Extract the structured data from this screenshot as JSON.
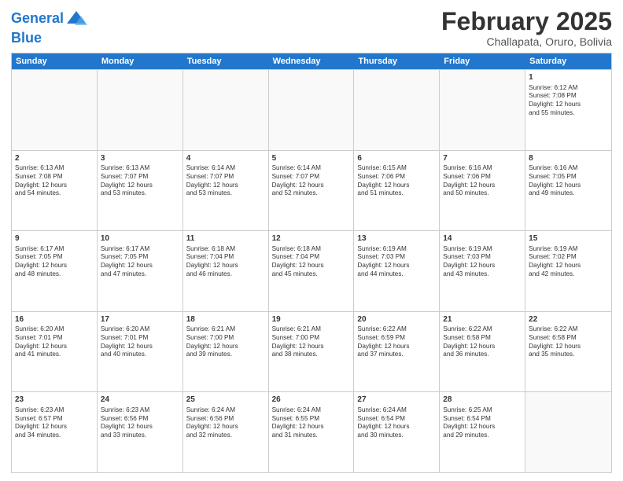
{
  "logo": {
    "line1": "General",
    "line2": "Blue"
  },
  "title": "February 2025",
  "location": "Challapata, Oruro, Bolivia",
  "days_of_week": [
    "Sunday",
    "Monday",
    "Tuesday",
    "Wednesday",
    "Thursday",
    "Friday",
    "Saturday"
  ],
  "weeks": [
    [
      {
        "day": "",
        "info": ""
      },
      {
        "day": "",
        "info": ""
      },
      {
        "day": "",
        "info": ""
      },
      {
        "day": "",
        "info": ""
      },
      {
        "day": "",
        "info": ""
      },
      {
        "day": "",
        "info": ""
      },
      {
        "day": "1",
        "info": "Sunrise: 6:12 AM\nSunset: 7:08 PM\nDaylight: 12 hours\nand 55 minutes."
      }
    ],
    [
      {
        "day": "2",
        "info": "Sunrise: 6:13 AM\nSunset: 7:08 PM\nDaylight: 12 hours\nand 54 minutes."
      },
      {
        "day": "3",
        "info": "Sunrise: 6:13 AM\nSunset: 7:07 PM\nDaylight: 12 hours\nand 53 minutes."
      },
      {
        "day": "4",
        "info": "Sunrise: 6:14 AM\nSunset: 7:07 PM\nDaylight: 12 hours\nand 53 minutes."
      },
      {
        "day": "5",
        "info": "Sunrise: 6:14 AM\nSunset: 7:07 PM\nDaylight: 12 hours\nand 52 minutes."
      },
      {
        "day": "6",
        "info": "Sunrise: 6:15 AM\nSunset: 7:06 PM\nDaylight: 12 hours\nand 51 minutes."
      },
      {
        "day": "7",
        "info": "Sunrise: 6:16 AM\nSunset: 7:06 PM\nDaylight: 12 hours\nand 50 minutes."
      },
      {
        "day": "8",
        "info": "Sunrise: 6:16 AM\nSunset: 7:05 PM\nDaylight: 12 hours\nand 49 minutes."
      }
    ],
    [
      {
        "day": "9",
        "info": "Sunrise: 6:17 AM\nSunset: 7:05 PM\nDaylight: 12 hours\nand 48 minutes."
      },
      {
        "day": "10",
        "info": "Sunrise: 6:17 AM\nSunset: 7:05 PM\nDaylight: 12 hours\nand 47 minutes."
      },
      {
        "day": "11",
        "info": "Sunrise: 6:18 AM\nSunset: 7:04 PM\nDaylight: 12 hours\nand 46 minutes."
      },
      {
        "day": "12",
        "info": "Sunrise: 6:18 AM\nSunset: 7:04 PM\nDaylight: 12 hours\nand 45 minutes."
      },
      {
        "day": "13",
        "info": "Sunrise: 6:19 AM\nSunset: 7:03 PM\nDaylight: 12 hours\nand 44 minutes."
      },
      {
        "day": "14",
        "info": "Sunrise: 6:19 AM\nSunset: 7:03 PM\nDaylight: 12 hours\nand 43 minutes."
      },
      {
        "day": "15",
        "info": "Sunrise: 6:19 AM\nSunset: 7:02 PM\nDaylight: 12 hours\nand 42 minutes."
      }
    ],
    [
      {
        "day": "16",
        "info": "Sunrise: 6:20 AM\nSunset: 7:01 PM\nDaylight: 12 hours\nand 41 minutes."
      },
      {
        "day": "17",
        "info": "Sunrise: 6:20 AM\nSunset: 7:01 PM\nDaylight: 12 hours\nand 40 minutes."
      },
      {
        "day": "18",
        "info": "Sunrise: 6:21 AM\nSunset: 7:00 PM\nDaylight: 12 hours\nand 39 minutes."
      },
      {
        "day": "19",
        "info": "Sunrise: 6:21 AM\nSunset: 7:00 PM\nDaylight: 12 hours\nand 38 minutes."
      },
      {
        "day": "20",
        "info": "Sunrise: 6:22 AM\nSunset: 6:59 PM\nDaylight: 12 hours\nand 37 minutes."
      },
      {
        "day": "21",
        "info": "Sunrise: 6:22 AM\nSunset: 6:58 PM\nDaylight: 12 hours\nand 36 minutes."
      },
      {
        "day": "22",
        "info": "Sunrise: 6:22 AM\nSunset: 6:58 PM\nDaylight: 12 hours\nand 35 minutes."
      }
    ],
    [
      {
        "day": "23",
        "info": "Sunrise: 6:23 AM\nSunset: 6:57 PM\nDaylight: 12 hours\nand 34 minutes."
      },
      {
        "day": "24",
        "info": "Sunrise: 6:23 AM\nSunset: 6:56 PM\nDaylight: 12 hours\nand 33 minutes."
      },
      {
        "day": "25",
        "info": "Sunrise: 6:24 AM\nSunset: 6:56 PM\nDaylight: 12 hours\nand 32 minutes."
      },
      {
        "day": "26",
        "info": "Sunrise: 6:24 AM\nSunset: 6:55 PM\nDaylight: 12 hours\nand 31 minutes."
      },
      {
        "day": "27",
        "info": "Sunrise: 6:24 AM\nSunset: 6:54 PM\nDaylight: 12 hours\nand 30 minutes."
      },
      {
        "day": "28",
        "info": "Sunrise: 6:25 AM\nSunset: 6:54 PM\nDaylight: 12 hours\nand 29 minutes."
      },
      {
        "day": "",
        "info": ""
      }
    ]
  ]
}
